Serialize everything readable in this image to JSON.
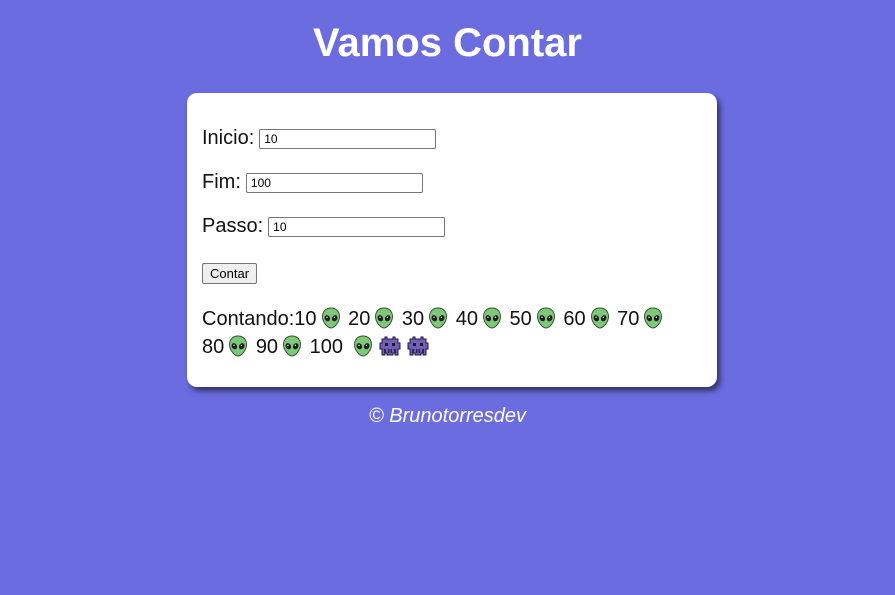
{
  "header": {
    "title": "Vamos Contar"
  },
  "form": {
    "inicio": {
      "label": "Inicio:",
      "value": "10"
    },
    "fim": {
      "label": "Fim:",
      "value": "100"
    },
    "passo": {
      "label": "Passo:",
      "value": "10"
    },
    "button_label": "Contar"
  },
  "result": {
    "prefix": "Contando:",
    "numbers": [
      "10",
      "20",
      "30",
      "40",
      "50",
      "60",
      "70",
      "80",
      "90",
      "100"
    ],
    "step_icon": "alien-icon",
    "end_icons": [
      "alien-icon",
      "alien-monster-icon",
      "alien-monster-icon"
    ]
  },
  "footer": {
    "text": "© Brunotorresdev"
  },
  "colors": {
    "background": "#6b6ce0",
    "card": "#ffffff",
    "alien": "#7fc77a",
    "monster": "#6f5fb8"
  }
}
